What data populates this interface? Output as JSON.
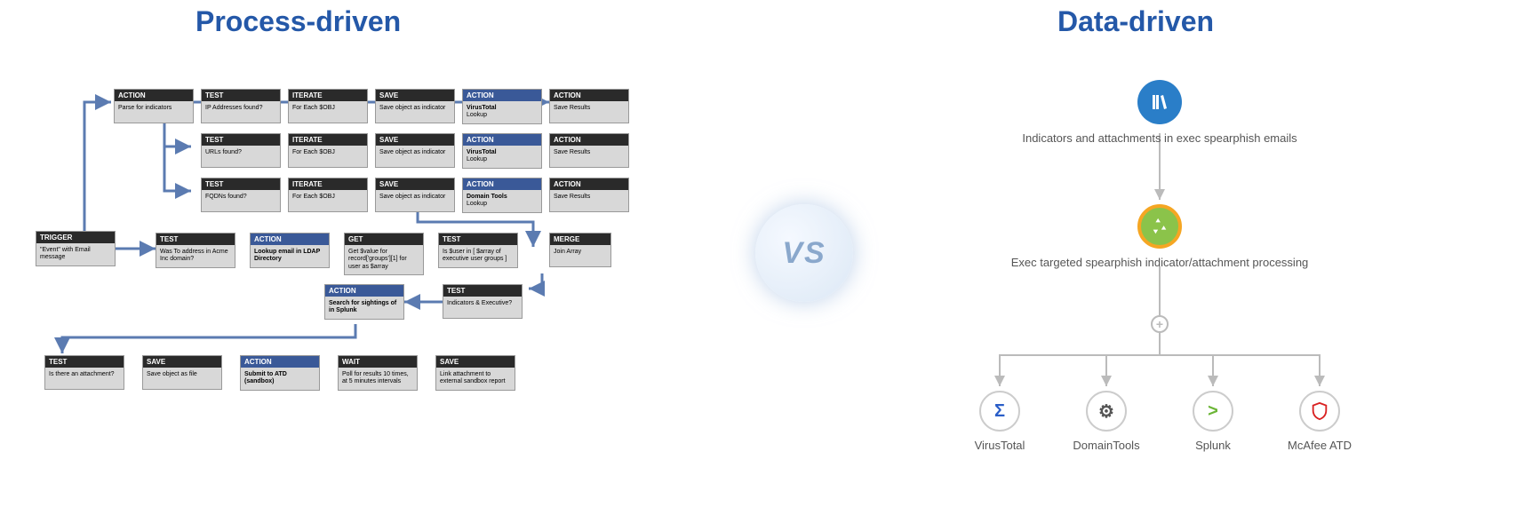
{
  "titles": {
    "left": "Process-driven",
    "right": "Data-driven"
  },
  "vs": "VS",
  "trigger": {
    "header": "TRIGGER",
    "body": "\"Event\" with Email message"
  },
  "row1": [
    {
      "h": "ACTION",
      "b": "Parse for indicators"
    },
    {
      "h": "TEST",
      "b": "IP Addresses found?"
    },
    {
      "h": "ITERATE",
      "b": "For Each $OBJ"
    },
    {
      "h": "SAVE",
      "b": "Save object as indicator"
    },
    {
      "h": "ACTION",
      "blue": true,
      "bold": true,
      "b": "VirusTotal",
      "sub": "Lookup"
    },
    {
      "h": "ACTION",
      "b": "Save Results"
    }
  ],
  "row2": [
    {
      "h": "TEST",
      "b": "URLs found?"
    },
    {
      "h": "ITERATE",
      "b": "For Each $OBJ"
    },
    {
      "h": "SAVE",
      "b": "Save object as indicator"
    },
    {
      "h": "ACTION",
      "blue": true,
      "bold": true,
      "b": "VirusTotal",
      "sub": "Lookup"
    },
    {
      "h": "ACTION",
      "b": "Save Results"
    }
  ],
  "row3": [
    {
      "h": "TEST",
      "b": "FQDNs found?"
    },
    {
      "h": "ITERATE",
      "b": "For Each $OBJ"
    },
    {
      "h": "SAVE",
      "b": "Save object as indicator"
    },
    {
      "h": "ACTION",
      "blue": true,
      "bold": true,
      "b": "Domain Tools",
      "sub": "Lookup"
    },
    {
      "h": "ACTION",
      "b": "Save Results"
    }
  ],
  "row4": [
    {
      "h": "TEST",
      "b": "Was To address in Acme Inc domain?"
    },
    {
      "h": "ACTION",
      "blue": true,
      "bold": true,
      "b": "Lookup email in LDAP Directory"
    },
    {
      "h": "GET",
      "b": "Get $value for record['groups'][1] for user as $array"
    },
    {
      "h": "TEST",
      "b": "Is $user in [ $array of executive user groups ]"
    },
    {
      "h": "MERGE",
      "b": "Join Array"
    }
  ],
  "row5": [
    {
      "h": "ACTION",
      "blue": true,
      "bold": true,
      "b": "Search for sightings of in Splunk"
    },
    {
      "h": "TEST",
      "b": "Indicators & Executive?"
    }
  ],
  "row6": [
    {
      "h": "TEST",
      "b": "Is there an attachment?"
    },
    {
      "h": "SAVE",
      "b": "Save object as file"
    },
    {
      "h": "ACTION",
      "blue": true,
      "bold": true,
      "b": "Submit to ATD (sandbox)"
    },
    {
      "h": "WAIT",
      "b": "Poll for results 10 times, at 5 minutes intervals"
    },
    {
      "h": "SAVE",
      "b": "Link attachment to external sandbox report"
    }
  ],
  "dd": {
    "node1": "Indicators and attachments in exec spearphish emails",
    "node2": "Exec targeted spearphish indicator/attachment processing",
    "tools": [
      "VirusTotal",
      "DomainTools",
      "Splunk",
      "McAfee ATD"
    ],
    "colors": {
      "vt": "#2a5ec8",
      "dt": "#555",
      "sp": "#6bb536",
      "mc": "#d92121"
    }
  }
}
